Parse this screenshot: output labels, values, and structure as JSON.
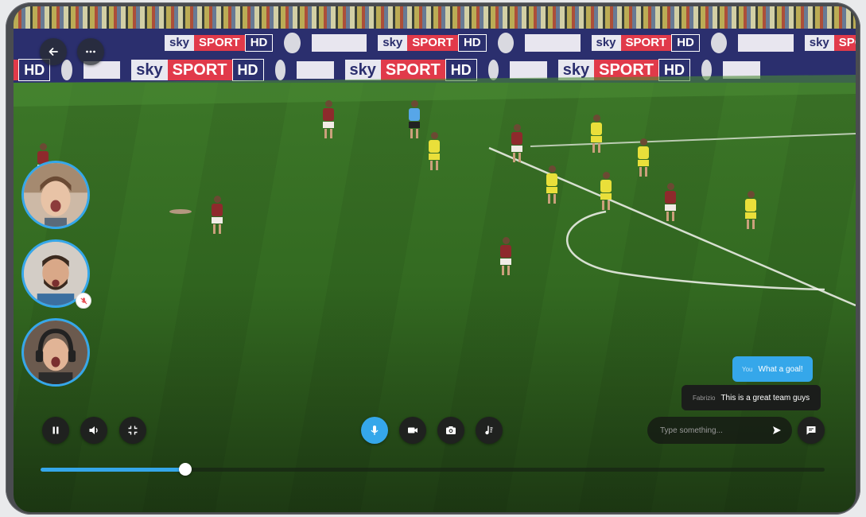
{
  "stadium": {
    "board_sky": "sky",
    "board_sport": "SPORT",
    "board_hd": "HD"
  },
  "participants": [
    {
      "name": "participant-1",
      "muted": false
    },
    {
      "name": "participant-2",
      "muted": true
    },
    {
      "name": "participant-3",
      "muted": false
    }
  ],
  "top_controls": {
    "back_icon": "back-arrow-icon",
    "more_icon": "more-horizontal-icon"
  },
  "player_controls": {
    "pause_icon": "pause-icon",
    "volume_icon": "volume-icon",
    "fullscreen_icon": "fullscreen-exit-icon"
  },
  "call_controls": {
    "mic_icon": "microphone-icon",
    "video_icon": "video-camera-icon",
    "camera_icon": "photo-camera-icon",
    "effects_icon": "music-note-icon"
  },
  "chat": {
    "messages": [
      {
        "sender": "You",
        "text": "What a goal!",
        "mine": true
      },
      {
        "sender": "Fabrizio",
        "text": "This is a great team guys",
        "mine": false
      }
    ],
    "input_placeholder": "Type something...",
    "send_icon": "send-icon",
    "toggle_icon": "chat-bubble-icon"
  },
  "playback": {
    "progress": 0.185
  },
  "colors": {
    "accent": "#35a7ea",
    "control_bg": "#1f211f",
    "bezel": "#4a4c50"
  }
}
